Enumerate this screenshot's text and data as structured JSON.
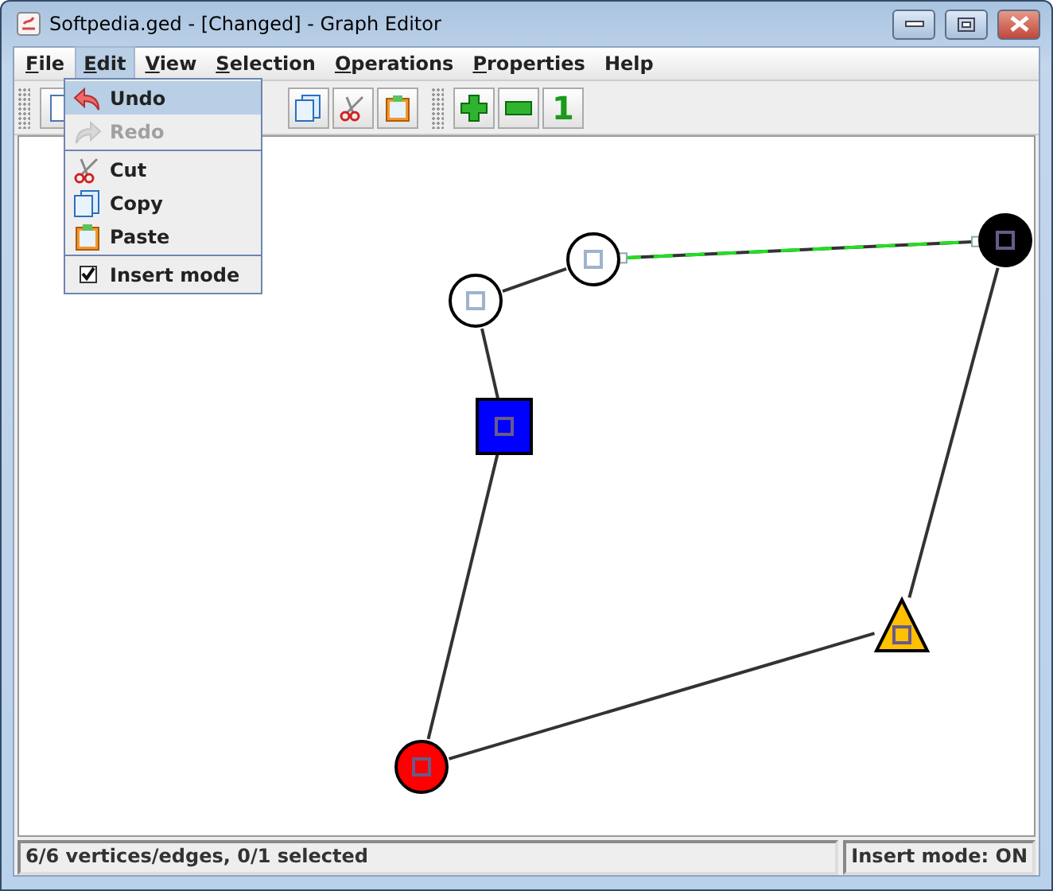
{
  "window": {
    "title": "Softpedia.ged - [Changed] - Graph Editor"
  },
  "menu_bar": [
    {
      "label": "File",
      "mnemonic": true,
      "selected": false
    },
    {
      "label": "Edit",
      "mnemonic": true,
      "selected": true
    },
    {
      "label": "View",
      "mnemonic": true,
      "selected": false
    },
    {
      "label": "Selection",
      "mnemonic": true,
      "selected": false
    },
    {
      "label": "Operations",
      "mnemonic": true,
      "selected": false
    },
    {
      "label": "Properties",
      "mnemonic": true,
      "selected": false
    },
    {
      "label": "Help",
      "mnemonic": false,
      "selected": false
    }
  ],
  "toolbar": [
    {
      "kind": "new"
    },
    {
      "kind": "gap"
    },
    {
      "kind": "copy"
    },
    {
      "kind": "cut"
    },
    {
      "kind": "paste"
    },
    {
      "kind": "grip"
    },
    {
      "kind": "add"
    },
    {
      "kind": "remove"
    },
    {
      "kind": "glyph",
      "glyph": "1"
    }
  ],
  "edit_menu": [
    [
      {
        "label": "Undo",
        "kind": "undo",
        "selected": true,
        "disabled": false
      },
      {
        "label": "Redo",
        "kind": "redo",
        "selected": false,
        "disabled": true
      }
    ],
    [
      {
        "label": "Cut",
        "kind": "cut",
        "selected": false,
        "disabled": false
      },
      {
        "label": "Copy",
        "kind": "copy",
        "selected": false,
        "disabled": false
      },
      {
        "label": "Paste",
        "kind": "paste",
        "selected": false,
        "disabled": false
      }
    ],
    [
      {
        "label": "Insert mode",
        "kind": "check",
        "checked": true,
        "selected": false,
        "disabled": false
      }
    ]
  ],
  "graph": {
    "nodes": [
      {
        "kind": "circle",
        "color": "#ffffff"
      },
      {
        "kind": "circle",
        "color": "#ffffff"
      },
      {
        "kind": "circle",
        "color": "#000000"
      },
      {
        "kind": "square",
        "color": "#0000ff"
      },
      {
        "kind": "circle",
        "color": "#ff0000"
      },
      {
        "kind": "triangle",
        "color": "#ffc000"
      }
    ],
    "edges": [
      {
        "selected": false
      },
      {
        "selected": true
      },
      {
        "selected": false
      },
      {
        "selected": false
      },
      {
        "selected": false
      },
      {
        "selected": false
      }
    ]
  },
  "status_bar": {
    "summary": "6/6 vertices/edges, 0/1 selected",
    "mode": "Insert mode: ON"
  }
}
